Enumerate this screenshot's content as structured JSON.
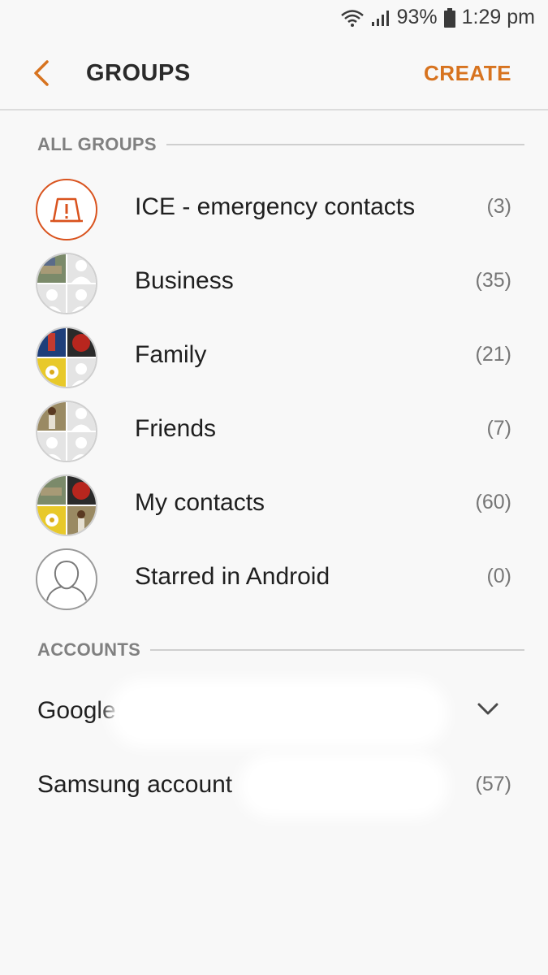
{
  "status_bar": {
    "battery": "93%",
    "time": "1:29 pm"
  },
  "header": {
    "title": "GROUPS",
    "create_label": "CREATE"
  },
  "colors": {
    "accent": "#d7731f",
    "ice_red": "#d9531e"
  },
  "sections": {
    "all_groups": "ALL GROUPS",
    "accounts": "ACCOUNTS"
  },
  "groups": [
    {
      "name": "ICE - emergency contacts",
      "count": "(3)",
      "icon": "ice-warning-icon"
    },
    {
      "name": "Business",
      "count": "(35)",
      "icon": "group-photo-avatar"
    },
    {
      "name": "Family",
      "count": "(21)",
      "icon": "group-photo-avatar"
    },
    {
      "name": "Friends",
      "count": "(7)",
      "icon": "group-photo-avatar"
    },
    {
      "name": "My contacts",
      "count": "(60)",
      "icon": "group-photo-avatar"
    },
    {
      "name": "Starred in Android",
      "count": "(0)",
      "icon": "person-outline-icon"
    }
  ],
  "accounts": [
    {
      "name": "Google",
      "icon": "chevron-down-icon"
    },
    {
      "name": "Samsung account",
      "count": "(57)"
    }
  ]
}
